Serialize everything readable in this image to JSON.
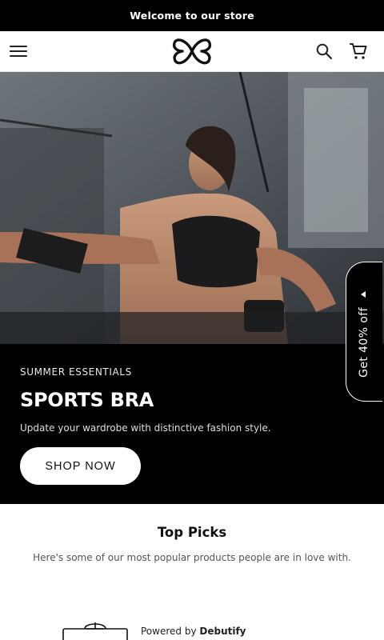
{
  "announcement": {
    "text": "Welcome to our store"
  },
  "header": {
    "menu_icon": "hamburger-menu-icon",
    "logo_icon": "butterfly-logo-icon",
    "search_icon": "search-icon",
    "cart_icon": "cart-icon"
  },
  "hero": {
    "image": "woman-sports-bra-gym-photo",
    "eyebrow": "SUMMER ESSENTIALS",
    "headline": "SPORTS BRA",
    "subtext": "Update your wardrobe with distinctive fashion style.",
    "cta_label": "SHOP NOW"
  },
  "discount_tab": {
    "label": "Get 40% off"
  },
  "top_picks": {
    "title": "Top Picks",
    "subtitle": "Here's some of our most popular products people are in love with."
  },
  "footer": {
    "powered_prefix": "Powered by ",
    "powered_brand": "Debutify"
  },
  "colors": {
    "bar": "#000000",
    "background": "#ffffff",
    "button": "#ffffff"
  }
}
